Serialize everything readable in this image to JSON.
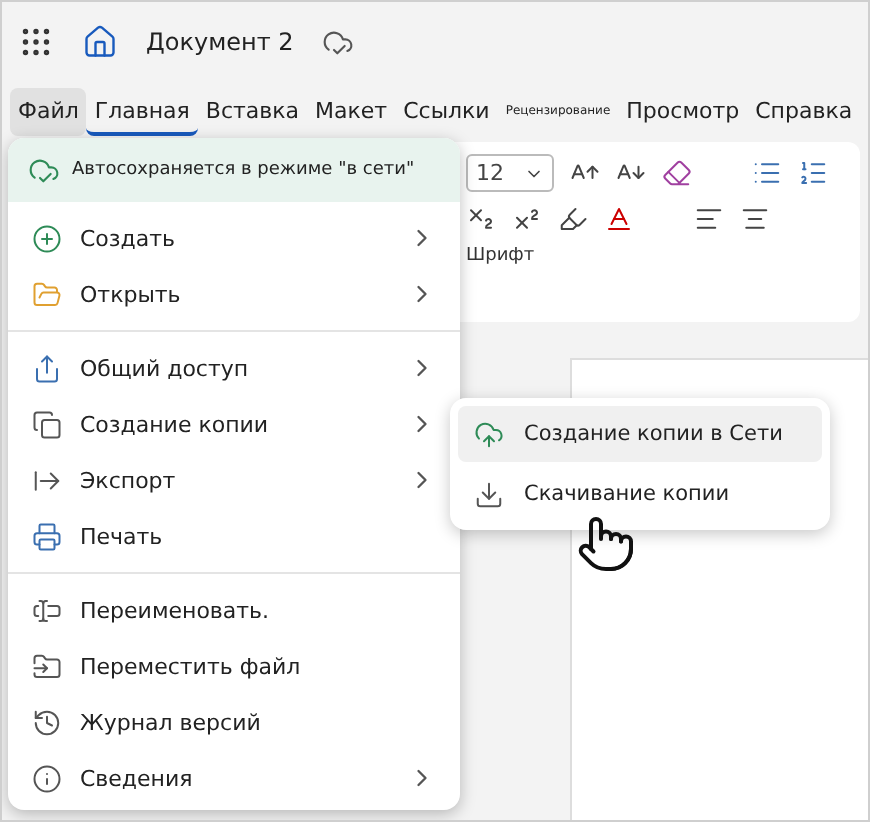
{
  "app_bar": {
    "title": "Документ 2"
  },
  "tabs": [
    {
      "label": "Файл",
      "selected": false,
      "open": true
    },
    {
      "label": "Главная",
      "selected": true,
      "open": false
    },
    {
      "label": "Вставка",
      "selected": false,
      "open": false
    },
    {
      "label": "Макет",
      "selected": false,
      "open": false
    },
    {
      "label": "Ссылки",
      "selected": false,
      "open": false
    },
    {
      "label": "Рецензирование",
      "selected": false,
      "open": false
    },
    {
      "label": "Просмотр",
      "selected": false,
      "open": false
    },
    {
      "label": "Справка",
      "selected": false,
      "open": false
    }
  ],
  "ribbon": {
    "font_size": "12",
    "group_label": "Шрифт"
  },
  "file_menu": {
    "banner": "Автосохраняется в режиме \"в сети\"",
    "sections": [
      [
        {
          "label": "Создать",
          "submenu": true
        },
        {
          "label": "Открыть",
          "submenu": true
        }
      ],
      [
        {
          "label": "Общий доступ",
          "submenu": true
        },
        {
          "label": "Создание копии",
          "submenu": true
        },
        {
          "label": "Экспорт",
          "submenu": true
        },
        {
          "label": "Печать",
          "submenu": false
        }
      ],
      [
        {
          "label": "Переименовать.",
          "submenu": false
        },
        {
          "label": "Переместить файл",
          "submenu": false
        },
        {
          "label": "Журнал версий",
          "submenu": false
        },
        {
          "label": "Сведения",
          "submenu": true
        }
      ]
    ]
  },
  "submenu": [
    {
      "label": "Создание копии в Сети",
      "selected": true
    },
    {
      "label": "Скачивание копии",
      "selected": false
    }
  ]
}
